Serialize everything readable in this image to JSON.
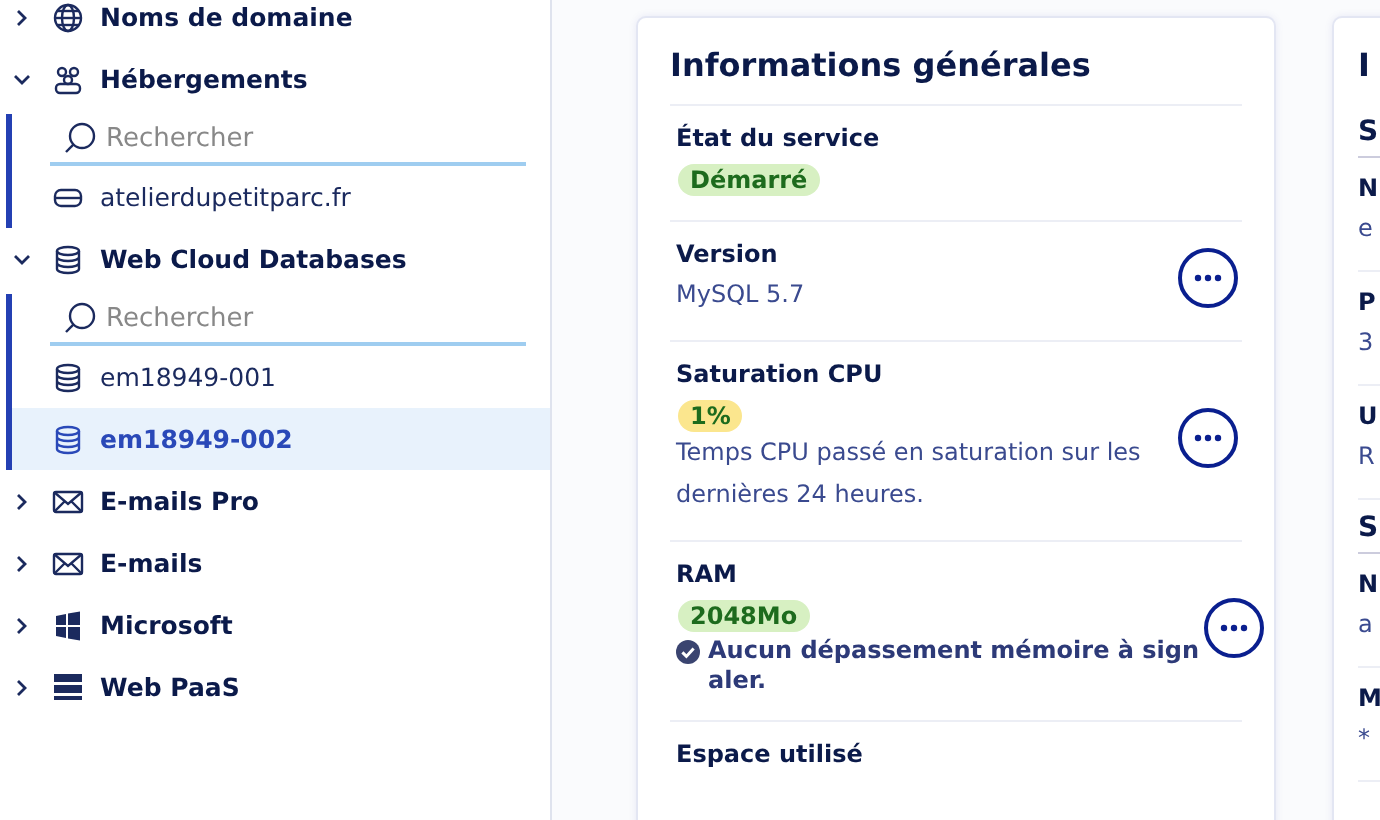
{
  "sidebar": {
    "items": [
      {
        "kind": "group",
        "label": "Noms de domaine",
        "expanded": false
      },
      {
        "kind": "group",
        "label": "Hébergements",
        "expanded": true,
        "children": [
          {
            "kind": "search",
            "placeholder": "Rechercher"
          },
          {
            "kind": "item",
            "label": "atelierdupetitparc.fr",
            "selected": false
          }
        ]
      },
      {
        "kind": "group",
        "label": "Web Cloud Databases",
        "expanded": true,
        "children": [
          {
            "kind": "search",
            "placeholder": "Rechercher"
          },
          {
            "kind": "item",
            "label": "em18949-001",
            "selected": false
          },
          {
            "kind": "item",
            "label": "em18949-002",
            "selected": true
          }
        ]
      },
      {
        "kind": "group",
        "label": "E-mails Pro",
        "expanded": false
      },
      {
        "kind": "group",
        "label": "E-mails",
        "expanded": false
      },
      {
        "kind": "group",
        "label": "Microsoft",
        "expanded": false
      },
      {
        "kind": "group",
        "label": "Web PaaS",
        "expanded": false
      }
    ]
  },
  "general_card": {
    "title": "Informations générales",
    "rows": [
      {
        "label": "État du service",
        "badge": {
          "text": "Démarré",
          "color": "#d7f0c2"
        },
        "menu": false
      },
      {
        "label": "Version",
        "value": "MySQL 5.7",
        "menu": true
      },
      {
        "label": "Saturation CPU",
        "badge": {
          "text": "1%",
          "color": "#fbe68e"
        },
        "value": "Temps CPU passé en saturation sur les dernières 24 heures.",
        "menu": true
      },
      {
        "label": "RAM",
        "badge": {
          "text": "2048Mo",
          "color": "#d7f0c2"
        },
        "status_note": "Aucun dépassement mémoire à sign aler.",
        "menu": true
      },
      {
        "label": "Espace utilisé",
        "menu": false
      }
    ]
  },
  "second_card": {
    "title": "I",
    "sections": [
      {
        "heading": "S",
        "rows": [
          {
            "label": "N",
            "value": "e"
          },
          {
            "label": "P",
            "value": "3"
          },
          {
            "label": "U",
            "value": "R"
          }
        ]
      },
      {
        "heading": "S",
        "rows": [
          {
            "label": "N",
            "value": "a"
          },
          {
            "label": "M",
            "value": "*"
          }
        ]
      }
    ]
  }
}
